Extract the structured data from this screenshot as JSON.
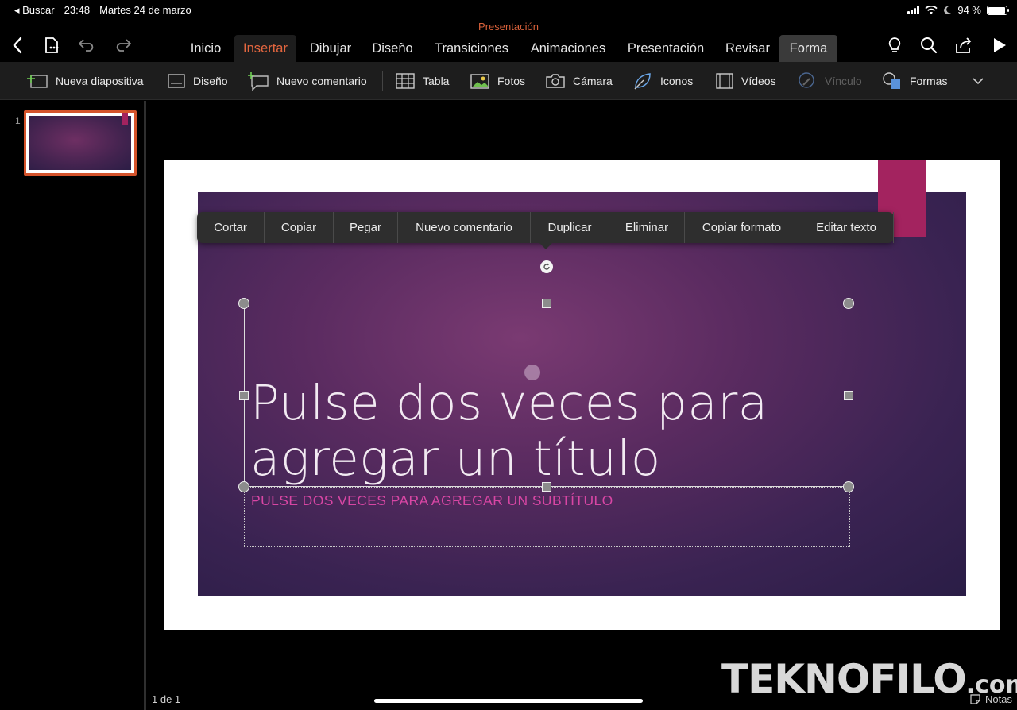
{
  "status": {
    "back_app": "◂ Buscar",
    "time": "23:48",
    "date": "Martes 24 de marzo",
    "battery": "94 %",
    "battery_level": 0.94
  },
  "document": {
    "title": "Presentación"
  },
  "tabs": [
    {
      "label": "Inicio"
    },
    {
      "label": "Insertar"
    },
    {
      "label": "Dibujar"
    },
    {
      "label": "Diseño"
    },
    {
      "label": "Transiciones"
    },
    {
      "label": "Animaciones"
    },
    {
      "label": "Presentación"
    },
    {
      "label": "Revisar"
    },
    {
      "label": "Forma"
    }
  ],
  "active_tab": "Insertar",
  "toolbar": {
    "nueva_diapositiva": "Nueva diapositiva",
    "diseno": "Diseño",
    "nuevo_comentario": "Nuevo comentario",
    "tabla": "Tabla",
    "fotos": "Fotos",
    "camara": "Cámara",
    "iconos": "Iconos",
    "videos": "Vídeos",
    "vinculo": "Vínculo",
    "formas": "Formas"
  },
  "thumbnails": [
    {
      "number": "1"
    }
  ],
  "context_menu": [
    {
      "label": "Cortar"
    },
    {
      "label": "Copiar"
    },
    {
      "label": "Pegar"
    },
    {
      "label": "Nuevo comentario"
    },
    {
      "label": "Duplicar"
    },
    {
      "label": "Eliminar"
    },
    {
      "label": "Copiar formato"
    },
    {
      "label": "Editar texto"
    }
  ],
  "slide": {
    "title_line1": "Pulse dos veces para",
    "title_line2": "agregar un título",
    "subtitle": "PULSE DOS VECES PARA AGREGAR UN SUBTÍTULO"
  },
  "footer": {
    "page": "1 de 1",
    "notes": "Notas",
    "watermark": "TEKNOFILO",
    "watermark_suffix": ".com"
  },
  "colors": {
    "accent_orange": "#d9613a",
    "slide_accent": "#a3235f",
    "subtitle_pink": "#d846a4"
  }
}
